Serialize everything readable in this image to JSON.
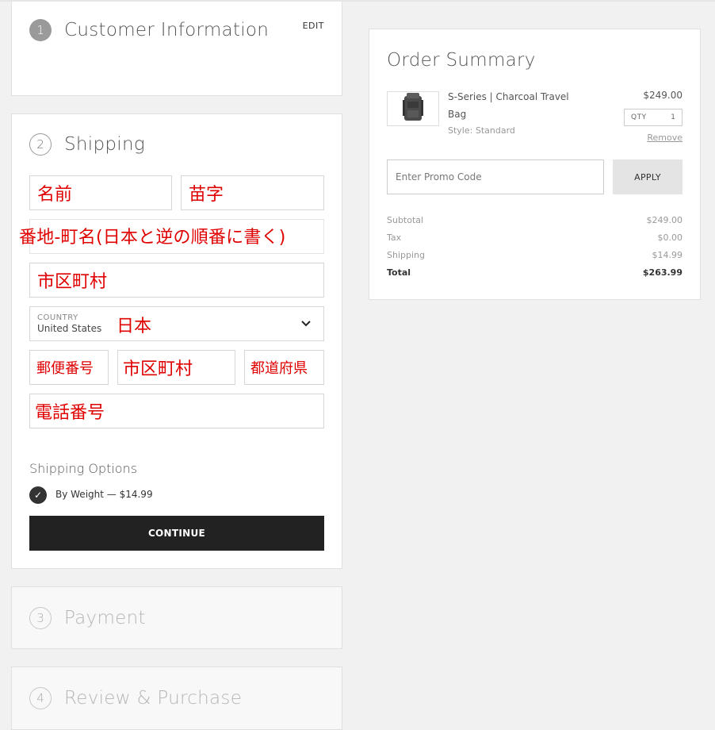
{
  "steps": {
    "customer": {
      "number": "1",
      "title": "Customer Information",
      "edit_label": "EDIT"
    },
    "shipping": {
      "number": "2",
      "title": "Shipping"
    },
    "payment": {
      "number": "3",
      "title": "Payment"
    },
    "review": {
      "number": "4",
      "title": "Review & Purchase"
    }
  },
  "shipping_form": {
    "first_name": "名前",
    "last_name": "苗字",
    "address": "番地-町名(日本と逆の順番に書く)",
    "city": "市区町村",
    "country": {
      "label": "COUNTRY",
      "value": "United States",
      "annotation": "日本"
    },
    "postal": "郵便番号",
    "city2": "市区町村",
    "prefecture": "都道府県",
    "phone": "電話番号",
    "options_label": "Shipping Options",
    "option_selected": "By Weight — $14.99",
    "continue_label": "CONTINUE"
  },
  "order_summary": {
    "title": "Order Summary",
    "item": {
      "name": "S-Series | Charcoal Travel Bag",
      "style": "Style: Standard",
      "price": "$249.00",
      "qty_label": "QTY",
      "qty_value": "1",
      "remove_label": "Remove",
      "thumb_icon": "backpack-icon"
    },
    "promo": {
      "placeholder": "Enter Promo Code",
      "apply_label": "APPLY"
    },
    "totals": [
      {
        "label": "Subtotal",
        "value": "$249.00"
      },
      {
        "label": "Tax",
        "value": "$0.00"
      },
      {
        "label": "Shipping",
        "value": "$14.99"
      },
      {
        "label": "Total",
        "value": "$263.99"
      }
    ]
  },
  "colors": {
    "annotation": "#e00000",
    "button_dark": "#222222",
    "page_bg": "#f1f1f1"
  }
}
